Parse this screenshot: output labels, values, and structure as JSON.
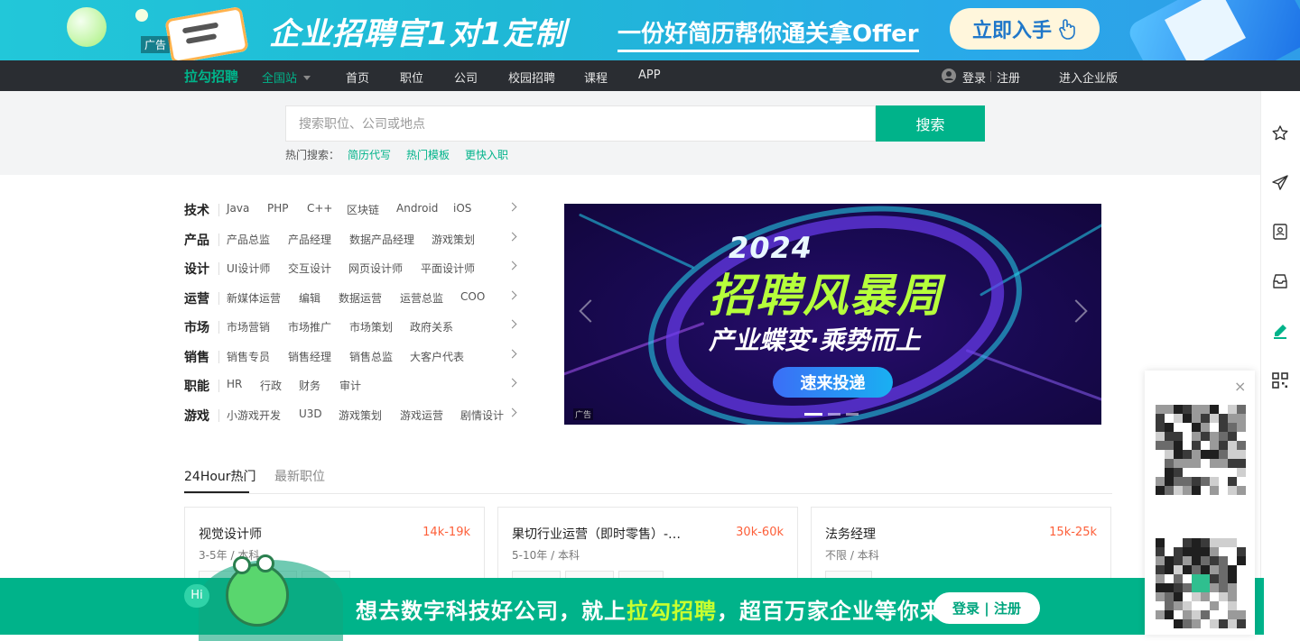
{
  "ad_banner": {
    "tag": "广告",
    "headline": "企业招聘官1对1定制",
    "subline": "一份好简历帮你通关拿Offer",
    "cta": "立即入手"
  },
  "nav": {
    "logo": "拉勾招聘",
    "station": "全国站",
    "links": [
      "首页",
      "职位",
      "公司",
      "校园招聘",
      "课程",
      "APP"
    ],
    "login": "登录",
    "register": "注册",
    "enterprise": "进入企业版"
  },
  "search": {
    "placeholder": "搜索职位、公司或地点",
    "button": "搜索",
    "hot_label": "热门搜索：",
    "hot_terms": [
      "简历代写",
      "热门模板",
      "更快入职"
    ]
  },
  "categories": [
    {
      "name": "技术",
      "tags": [
        "Java",
        "PHP",
        "C++",
        "区块链",
        "Android",
        "iOS"
      ]
    },
    {
      "name": "产品",
      "tags": [
        "产品总监",
        "产品经理",
        "数据产品经理",
        "游戏策划"
      ]
    },
    {
      "name": "设计",
      "tags": [
        "UI设计师",
        "交互设计",
        "网页设计师",
        "平面设计师"
      ]
    },
    {
      "name": "运营",
      "tags": [
        "新媒体运营",
        "编辑",
        "数据运营",
        "运营总监",
        "COO"
      ]
    },
    {
      "name": "市场",
      "tags": [
        "市场营销",
        "市场推广",
        "市场策划",
        "政府关系"
      ]
    },
    {
      "name": "销售",
      "tags": [
        "销售专员",
        "销售经理",
        "销售总监",
        "大客户代表"
      ]
    },
    {
      "name": "职能",
      "tags": [
        "HR",
        "行政",
        "财务",
        "审计"
      ]
    },
    {
      "name": "游戏",
      "tags": [
        "小游戏开发",
        "U3D",
        "游戏策划",
        "游戏运营",
        "剧情设计"
      ]
    }
  ],
  "carousel": {
    "year": "2024",
    "title": "招聘风暴周",
    "subtitle": "产业蝶变·乘势而上",
    "button": "速来投递",
    "ad_tag": "广告",
    "active_slide": 1,
    "slide_count": 3
  },
  "tabs": [
    "24Hour热门",
    "最新职位"
  ],
  "jobs": [
    {
      "title": "视觉设计师",
      "salary": "14k-19k",
      "experience": "3-5年",
      "education": "本科"
    },
    {
      "title": "果切行业运营（即时零售）-…",
      "salary": "30k-60k",
      "experience": "5-10年",
      "education": "本科"
    },
    {
      "title": "法务经理",
      "salary": "15k-25k",
      "experience": "不限",
      "education": "本科"
    }
  ],
  "meta_separator": "/",
  "qr_popup": {
    "close": "×"
  },
  "promo": {
    "hi": "Hi",
    "text_before": "想去数字科技好公司，就上",
    "highlight": "拉勾招聘",
    "text_after": "，超百万家企业等你来",
    "button": "登录 | 注册"
  },
  "rail_icons": [
    "star-icon",
    "send-icon",
    "resume-icon",
    "inbox-icon",
    "edit-icon",
    "qrcode-icon"
  ],
  "colors": {
    "brand": "#00b38a",
    "salary": "#fd5f39",
    "nav_bg": "#2a2d32"
  }
}
